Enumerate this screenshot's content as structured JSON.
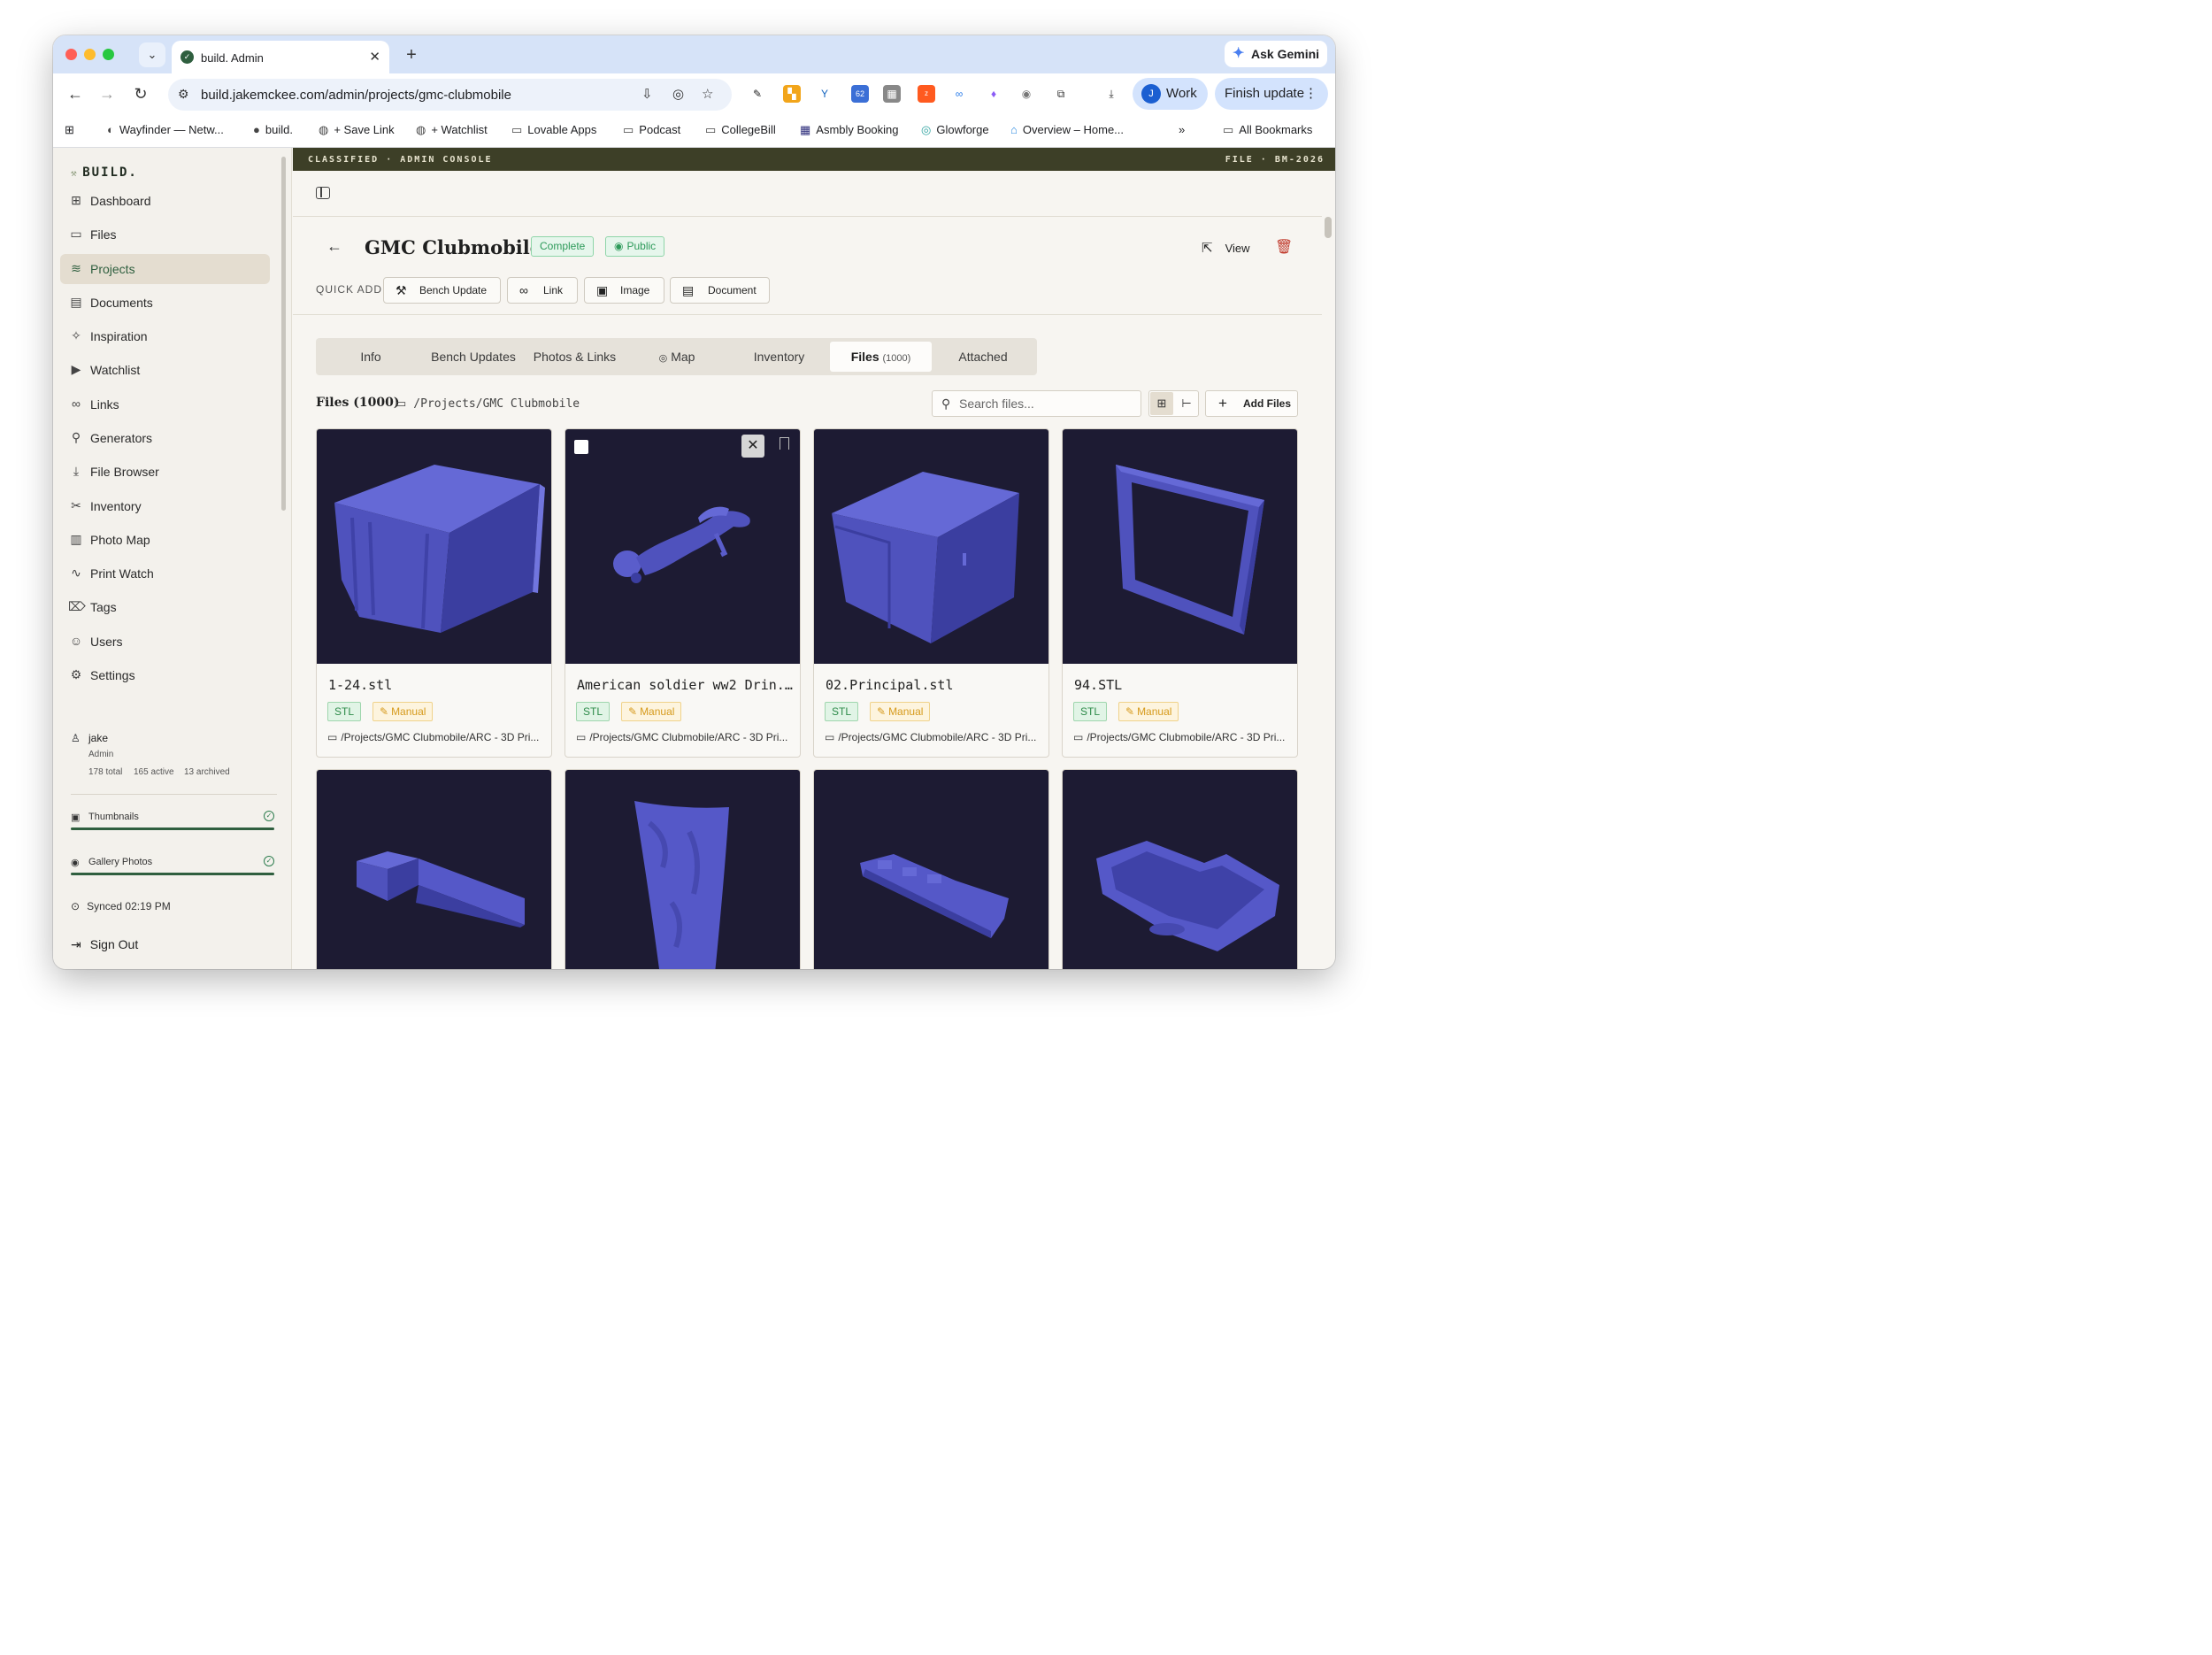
{
  "browser": {
    "tab_title": "build. Admin",
    "url": "build.jakemckee.com/admin/projects/gmc-clubmobile",
    "ask_gemini": "Ask Gemini",
    "profile_label": "Work",
    "profile_initial": "J",
    "finish_update": "Finish update",
    "ext_badge": "62",
    "bookmarks": [
      "Wayfinder — Netw...",
      "build.",
      "+ Save Link",
      "+ Watchlist",
      "Lovable Apps",
      "Podcast",
      "CollegeBill",
      "Asmbly Booking",
      "Glowforge",
      "Overview – Home..."
    ],
    "all_bookmarks": "All Bookmarks"
  },
  "sidebar": {
    "brand": "BUILD.",
    "items": [
      {
        "label": "Dashboard",
        "icon": "dashboard-icon"
      },
      {
        "label": "Files",
        "icon": "folder-icon"
      },
      {
        "label": "Projects",
        "icon": "layers-icon",
        "active": true
      },
      {
        "label": "Documents",
        "icon": "document-icon"
      },
      {
        "label": "Inspiration",
        "icon": "sparkles-icon"
      },
      {
        "label": "Watchlist",
        "icon": "play-icon"
      },
      {
        "label": "Links",
        "icon": "link-icon"
      },
      {
        "label": "Generators",
        "icon": "wrench-icon"
      },
      {
        "label": "File Browser",
        "icon": "download-box-icon"
      },
      {
        "label": "Inventory",
        "icon": "tools-icon"
      },
      {
        "label": "Photo Map",
        "icon": "map-icon"
      },
      {
        "label": "Print Watch",
        "icon": "activity-icon"
      },
      {
        "label": "Tags",
        "icon": "tags-icon"
      },
      {
        "label": "Users",
        "icon": "users-icon"
      },
      {
        "label": "Settings",
        "icon": "gear-icon"
      }
    ],
    "user": {
      "name": "jake",
      "role": "Admin",
      "total": "178 total",
      "active": "165 active",
      "archived": "13 archived"
    },
    "jobs": [
      {
        "label": "Thumbnails",
        "progress": 1.0
      },
      {
        "label": "Gallery Photos",
        "progress": 1.0
      }
    ],
    "synced": "Synced 02:19 PM",
    "sign_out": "Sign Out"
  },
  "banner": {
    "left": "CLASSIFIED · ADMIN CONSOLE",
    "right": "FILE · BM-2026"
  },
  "project": {
    "title": "GMC Clubmobile",
    "status_badge": "Complete",
    "visibility_badge": "Public",
    "view_label": "View",
    "quick_add_label": "QUICK ADD",
    "quick_add": [
      "Bench Update",
      "Link",
      "Image",
      "Document"
    ]
  },
  "tabs": [
    {
      "label": "Info"
    },
    {
      "label": "Bench Updates"
    },
    {
      "label": "Photos & Links"
    },
    {
      "label": "Map"
    },
    {
      "label": "Inventory"
    },
    {
      "label": "Files",
      "count": "(1000)",
      "active": true
    },
    {
      "label": "Attached"
    }
  ],
  "files": {
    "heading": "Files (1000)",
    "path": "/Projects/GMC Clubmobile",
    "search_placeholder": "Search files...",
    "add_files": "Add Files",
    "items": [
      {
        "name": "1-24.stl",
        "type": "STL",
        "source": "Manual",
        "path": "/Projects/GMC Clubmobile/ARC - 3D Pri..."
      },
      {
        "name": "American soldier ww2 Drin...",
        "type": "STL",
        "source": "Manual",
        "path": "/Projects/GMC Clubmobile/ARC - 3D Pri...",
        "hovered": true
      },
      {
        "name": "02.Principal.stl",
        "type": "STL",
        "source": "Manual",
        "path": "/Projects/GMC Clubmobile/ARC - 3D Pri..."
      },
      {
        "name": "94.STL",
        "type": "STL",
        "source": "Manual",
        "path": "/Projects/GMC Clubmobile/ARC - 3D Pri..."
      },
      {
        "name": "",
        "type": "",
        "source": "",
        "path": ""
      },
      {
        "name": "",
        "type": "",
        "source": "",
        "path": ""
      },
      {
        "name": "",
        "type": "",
        "source": "",
        "path": ""
      },
      {
        "name": "",
        "type": "",
        "source": "",
        "path": ""
      }
    ]
  },
  "colors": {
    "accent": "#2f5f3f",
    "banner": "#3d3f27",
    "thumb_bg": "#1d1b33",
    "model": "#5558c8",
    "danger": "#c0392b"
  }
}
